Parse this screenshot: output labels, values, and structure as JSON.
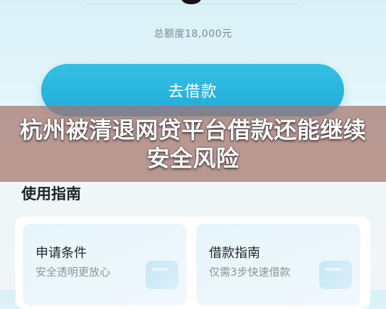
{
  "loan": {
    "total_amount_label": "总额度18,000元",
    "borrow_button_label": "去借款"
  },
  "banner": {
    "title": "杭州被清退网贷平台借款还能继续安全风险"
  },
  "guide": {
    "heading": "使用指南",
    "cards": [
      {
        "title": "申请条件",
        "subtitle": "安全透明更放心"
      },
      {
        "title": "借款指南",
        "subtitle": "仅需3步快速借款"
      }
    ]
  },
  "colors": {
    "accent": "#29b6df",
    "background": "#e3f4f9",
    "banner_overlay": "#a57369"
  }
}
